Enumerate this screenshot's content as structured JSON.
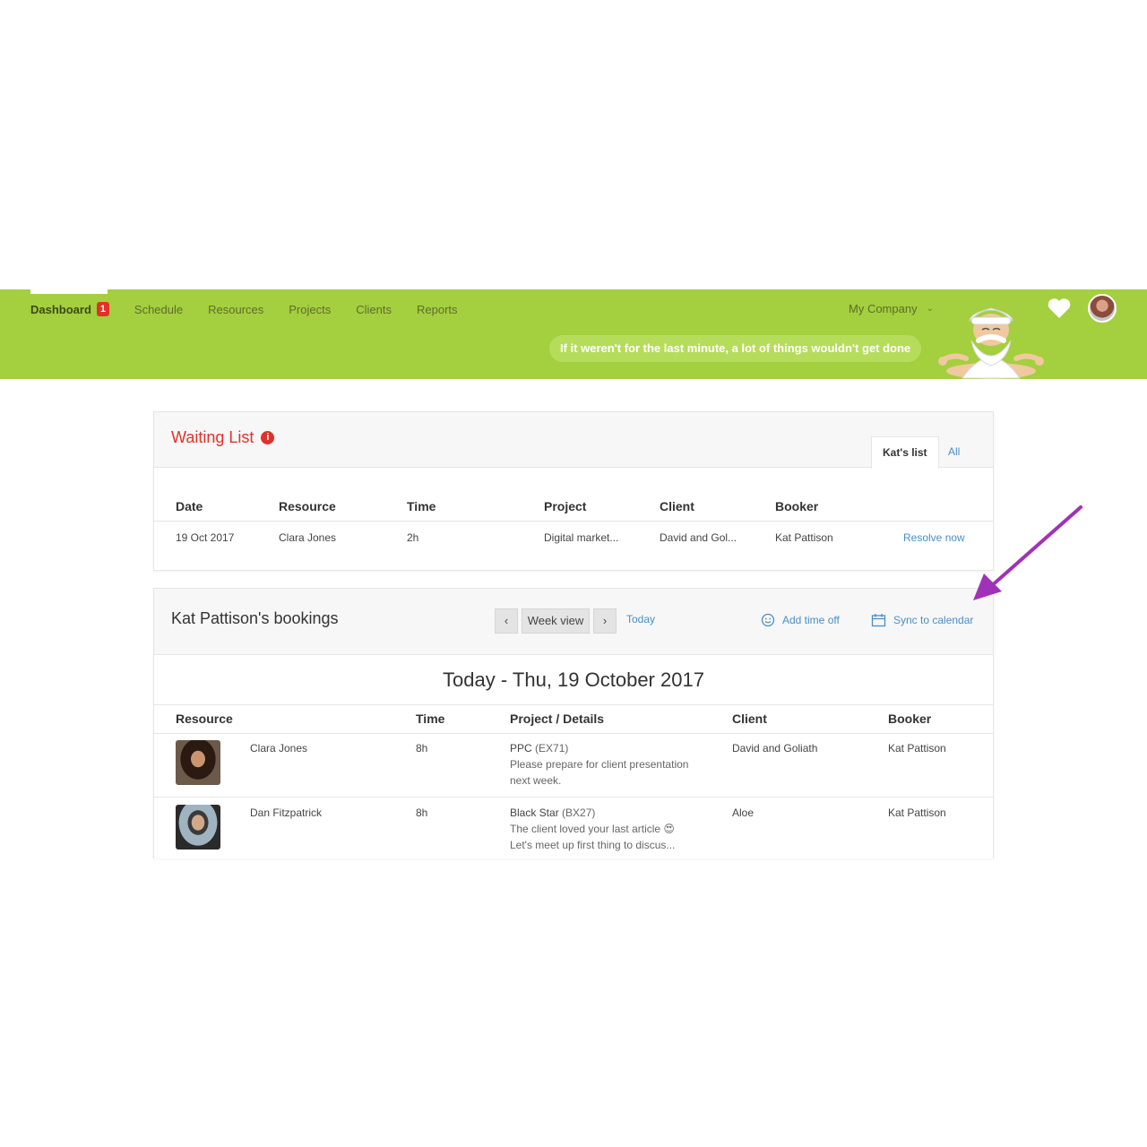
{
  "nav": {
    "items": [
      {
        "label": "Dashboard",
        "badge": "1",
        "active": true
      },
      {
        "label": "Schedule"
      },
      {
        "label": "Resources"
      },
      {
        "label": "Projects"
      },
      {
        "label": "Clients"
      },
      {
        "label": "Reports"
      }
    ],
    "company": "My Company",
    "quote": "If it weren't for the last minute, a lot of things wouldn't get done",
    "accent_color": "#a4cf3e"
  },
  "waiting_list": {
    "title": "Waiting List",
    "tabs": [
      "Kat's list",
      "All"
    ],
    "columns": [
      "Date",
      "Resource",
      "Time",
      "Project",
      "Client",
      "Booker"
    ],
    "rows": [
      {
        "date": "19 Oct 2017",
        "resource": "Clara Jones",
        "time": "2h",
        "project": "Digital market...",
        "client": "David and Gol...",
        "booker": "Kat Pattison",
        "action": "Resolve now"
      }
    ]
  },
  "bookings": {
    "title": "Kat Pattison's bookings",
    "view": "Week view",
    "today": "Today",
    "add_time_off": "Add time off",
    "sync": "Sync to calendar",
    "date_heading": "Today - Thu, 19 October 2017",
    "columns": [
      "Resource",
      "Time",
      "Project / Details",
      "Client",
      "Booker"
    ],
    "rows": [
      {
        "resource": "Clara Jones",
        "time": "8h",
        "project": "PPC",
        "code": "(EX71)",
        "details1": "Please prepare for client presentation",
        "details2": "next week.",
        "client": "David and Goliath",
        "booker": "Kat Pattison"
      },
      {
        "resource": "Dan Fitzpatrick",
        "time": "8h",
        "project": "Black Star",
        "code": "(BX27)",
        "details1": "The client loved your last article 😍",
        "details2": "Let's meet up first thing to discus...",
        "client": "Aloe",
        "booker": "Kat Pattison"
      }
    ]
  }
}
